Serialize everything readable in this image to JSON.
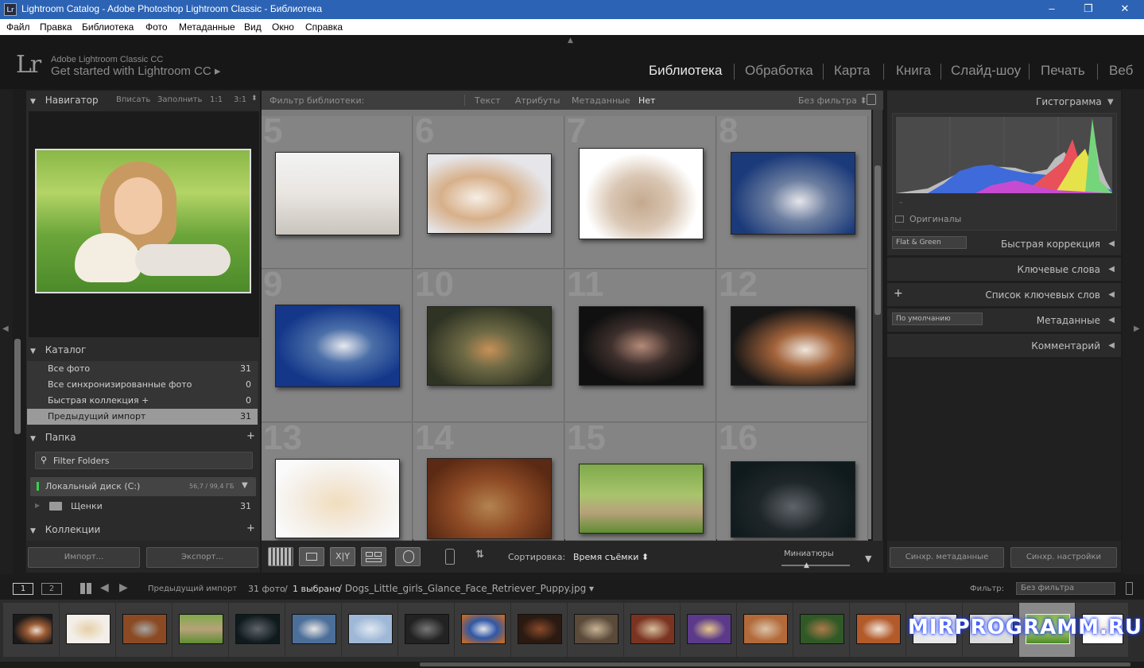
{
  "window": {
    "title": "Lightroom Catalog - Adobe Photoshop Lightroom Classic - Библиотека",
    "icon": "Lr",
    "minimize": "–",
    "maximize": "❐",
    "close": "✕"
  },
  "menu": [
    "Файл",
    "Правка",
    "Библиотека",
    "Фото",
    "Метаданные",
    "Вид",
    "Окно",
    "Справка"
  ],
  "identity": {
    "logo": "Lr",
    "product": "Adobe Lightroom Classic CC",
    "tagline": "Get started with Lightroom CC ▸"
  },
  "modules": [
    "Библиотека",
    "Обработка",
    "Карта",
    "Книга",
    "Слайд-шоу",
    "Печать",
    "Веб"
  ],
  "navigator": {
    "title": "Навигатор",
    "zoom": [
      "Вписать",
      "Заполнить",
      "1:1",
      "3:1"
    ]
  },
  "catalog": {
    "title": "Каталог",
    "items": [
      {
        "label": "Все фото",
        "count": "31"
      },
      {
        "label": "Все синхронизированные фото",
        "count": "0"
      },
      {
        "label": "Быстрая коллекция  +",
        "count": "0"
      },
      {
        "label": "Предыдущий импорт",
        "count": "31"
      }
    ]
  },
  "folders": {
    "title": "Папка",
    "filter_placeholder": "Filter Folders",
    "disk": "Локальный диск (C:)",
    "disk_space": "56,7 / 99,4 ГБ",
    "folder": "Щенки",
    "folder_count": "31"
  },
  "collections": {
    "title": "Коллекции"
  },
  "left_buttons": {
    "import": "Импорт...",
    "export": "Экспорт..."
  },
  "filter_bar": {
    "label": "Фильтр библиотеки:",
    "tabs": [
      "Текст",
      "Атрибуты",
      "Метаданные",
      "Нет"
    ],
    "preset": "Без фильтра ⬍"
  },
  "grid": {
    "numbers": [
      "5",
      "6",
      "7",
      "8",
      "9",
      "10",
      "11",
      "12",
      "13",
      "14",
      "15",
      "16"
    ]
  },
  "toolbar": {
    "sort_label": "Сортировка:",
    "sort_value": "Время съёмки ⬍",
    "thumbs_label": "Миниатюры"
  },
  "right_panel": {
    "histogram": "Гистограмма",
    "originals": "Оригиналы",
    "quick_develop": "Быстрая коррекция",
    "quick_preset": "Flat & Green",
    "keywords": "Ключевые слова",
    "keyword_list": "Список ключевых слов",
    "metadata": "Метаданные",
    "metadata_preset": "По умолчанию",
    "comments": "Комментарий",
    "sync_meta": "Синхр. метаданные",
    "sync_settings": "Синхр. настройки"
  },
  "filmstrip": {
    "page1": "1",
    "page2": "2",
    "source": "Предыдущий импорт",
    "count": "31 фото",
    "slash": "/",
    "selected": "1 выбрано",
    "filename": "/ Dogs_Little_girls_Glance_Face_Retriever_Puppy.jpg ▾",
    "filter_label": "Фильтр:",
    "filter_value": "Без фильтра"
  },
  "watermark": "MIRPROGRAMM.RU"
}
